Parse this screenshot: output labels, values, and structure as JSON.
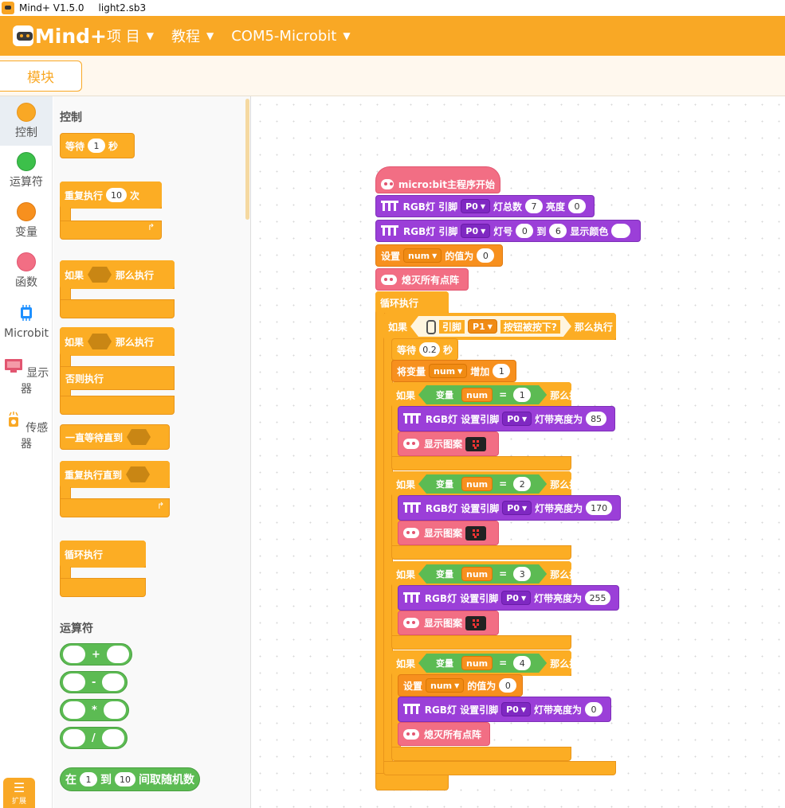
{
  "titlebar": {
    "app": "Mind+ V1.5.0",
    "file": "light2.sb3"
  },
  "menubar": {
    "logo": "Mind+",
    "items": [
      "项 目",
      "教程",
      "COM5-Microbit"
    ]
  },
  "subbar": {
    "tab": "模块"
  },
  "categories": [
    {
      "label": "控制",
      "color": "#f9a825"
    },
    {
      "label": "运算符",
      "color": "#3cc04a"
    },
    {
      "label": "变量",
      "color": "#f7901e"
    },
    {
      "label": "函数",
      "color": "#f26e84"
    },
    {
      "label": "Microbit",
      "color": "#1e90ff"
    },
    {
      "label": "显示器",
      "color": "#e25570"
    },
    {
      "label": "传感器",
      "color": "#f9a825"
    }
  ],
  "expand": {
    "label": "扩展"
  },
  "palette": {
    "control_title": "控制",
    "wait": {
      "label": "等待",
      "value": "1",
      "unit": "秒"
    },
    "repeat": {
      "label": "重复执行",
      "value": "10",
      "unit": "次"
    },
    "if_then": {
      "label1": "如果",
      "label2": "那么执行"
    },
    "if_else": {
      "label1": "如果",
      "label2": "那么执行",
      "else": "否则执行"
    },
    "wait_until": {
      "label": "一直等待直到"
    },
    "repeat_until": {
      "label": "重复执行直到"
    },
    "forever": {
      "label": "循环执行"
    },
    "operators_title": "运算符",
    "ops": [
      "+",
      "-",
      "*",
      "/"
    ],
    "random": {
      "label1": "在",
      "v1": "1",
      "label2": "到",
      "v2": "10",
      "label3": "间取随机数"
    }
  },
  "script": {
    "hat": "micro:bit主程序开始",
    "rgb_init": {
      "label1": "RGB灯 引脚",
      "pin": "P0",
      "label2": "灯总数",
      "count": "7",
      "label3": "亮度",
      "brightness": "0"
    },
    "rgb_color": {
      "label1": "RGB灯 引脚",
      "pin": "P0",
      "label2": "灯号",
      "from": "0",
      "label3": "到",
      "to": "6",
      "label4": "显示颜色"
    },
    "set_var": {
      "label1": "设置",
      "var": "num",
      "label2": "的值为",
      "value": "0"
    },
    "clear": "熄灭所有点阵",
    "forever": "循环执行",
    "if_button": {
      "label1": "如果",
      "label2": "引脚",
      "pin": "P1",
      "label3": "按钮被按下?",
      "label4": "那么执行"
    },
    "wait": {
      "label": "等待",
      "value": "0.2",
      "unit": "秒"
    },
    "change_var": {
      "label1": "将变量",
      "var": "num",
      "label2": "增加",
      "value": "1"
    },
    "cases": [
      {
        "if": "如果",
        "var_label": "变量",
        "var": "num",
        "eq": "=",
        "value": "1",
        "then": "那么执行",
        "rgb": "RGB灯 设置引脚",
        "pin": "P0",
        "bright_label": "灯带亮度为",
        "bright": "85",
        "show": "显示图案"
      },
      {
        "if": "如果",
        "var_label": "变量",
        "var": "num",
        "eq": "=",
        "value": "2",
        "then": "那么执行",
        "rgb": "RGB灯 设置引脚",
        "pin": "P0",
        "bright_label": "灯带亮度为",
        "bright": "170",
        "show": "显示图案"
      },
      {
        "if": "如果",
        "var_label": "变量",
        "var": "num",
        "eq": "=",
        "value": "3",
        "then": "那么执行",
        "rgb": "RGB灯 设置引脚",
        "pin": "P0",
        "bright_label": "灯带亮度为",
        "bright": "255",
        "show": "显示图案"
      }
    ],
    "case4": {
      "if": "如果",
      "var_label": "变量",
      "var": "num",
      "eq": "=",
      "value": "4",
      "then": "那么执行",
      "set_label1": "设置",
      "set_var": "num",
      "set_label2": "的值为",
      "set_value": "0",
      "rgb": "RGB灯 设置引脚",
      "pin": "P0",
      "bright_label": "灯带亮度为",
      "bright": "0",
      "clear": "熄灭所有点阵"
    }
  },
  "colors": {
    "control": "#fcad24",
    "operator": "#5cbb53",
    "variable": "#f7901e",
    "rgb": "#9b3fd8",
    "display": "#f26e84",
    "menubar": "#f9a825"
  }
}
